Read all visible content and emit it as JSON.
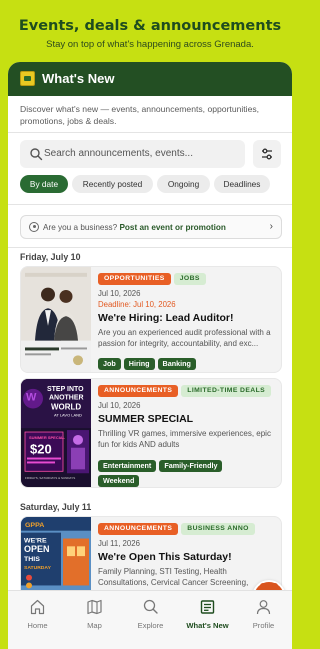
{
  "promo": {
    "title": "Events, deals & announcements",
    "subtitle": "Stay on top of what's happening across Grenada."
  },
  "app": {
    "title": "What's New",
    "intro": "Discover what's new — events, announcements, opportunities, promotions, jobs & deals."
  },
  "search": {
    "placeholder": "Search announcements, events..."
  },
  "filters": [
    {
      "label": "By date",
      "active": true
    },
    {
      "label": "Recently posted",
      "active": false
    },
    {
      "label": "Ongoing",
      "active": false
    },
    {
      "label": "Deadlines",
      "active": false
    }
  ],
  "business": {
    "prompt": "Are you a business?",
    "link": "Post an event or promotion"
  },
  "sections": [
    {
      "date": "Friday, July 10",
      "cards": [
        {
          "tags": [
            "OPPORTUNITIES",
            "JOBS"
          ],
          "date": "Jul 10, 2026",
          "deadline": "Deadline: Jul 10, 2026",
          "title": "We're Hiring: Lead Auditor!",
          "desc": "Are you an experienced audit professional with a passion for integrity, accountability, and exc...",
          "chips": [
            "Job",
            "Hiring",
            "Banking"
          ]
        },
        {
          "tags": [
            "ANNOUNCEMENTS",
            "LIMITED-TIME DEALS"
          ],
          "date": "Jul 10, 2026",
          "title": "SUMMER SPECIAL",
          "desc": "Thrilling VR games, immersive experiences, epic fun for kids AND adults",
          "chips": [
            "Entertainment",
            "Family-Friendly",
            "Weekend"
          ]
        }
      ]
    },
    {
      "date": "Saturday, July 11",
      "cards": [
        {
          "tags": [
            "ANNOUNCEMENTS",
            "BUSINESS ANNO"
          ],
          "date": "Jul 11, 2026",
          "title": "We're Open This Saturday!",
          "desc": "Family Planning, STI Testing, Health Consultations, Cervical Cancer Screening, Health..."
        }
      ]
    }
  ],
  "thumb2": {
    "line1": "STEP INTO",
    "line2": "ANOTHER",
    "line3": "WORLD",
    "sub": "AT LAVO LAND",
    "price": "$20",
    "banner": "SUMMER SPECIAL",
    "small": "FRIDAYS, SATURDAYS & SUNDAYS"
  },
  "thumb3": {
    "brand": "GPPA",
    "text1": "WE'RE",
    "text2": "OPEN",
    "text3": "THIS",
    "text4": "SATURDAY"
  },
  "nav": [
    {
      "label": "Home",
      "icon": "home-icon",
      "active": false
    },
    {
      "label": "Map",
      "icon": "map-icon",
      "active": false
    },
    {
      "label": "Explore",
      "icon": "explore-icon",
      "active": false
    },
    {
      "label": "What's New",
      "icon": "news-icon",
      "active": true
    },
    {
      "label": "Profile",
      "icon": "profile-icon",
      "active": false
    }
  ],
  "colors": {
    "lime": "#c6e012",
    "forest": "#234f23",
    "accent": "#e85f25",
    "chip_active": "#2a6b33"
  }
}
